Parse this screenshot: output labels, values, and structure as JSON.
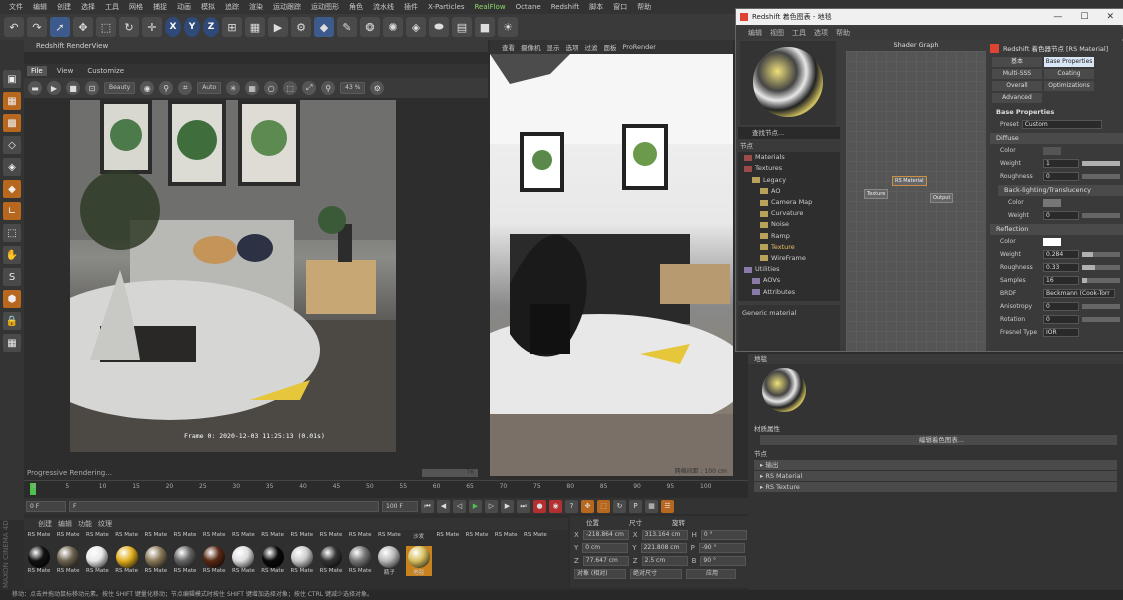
{
  "menu": [
    "文件",
    "编辑",
    "创建",
    "选择",
    "工具",
    "网格",
    "捕捉",
    "动画",
    "模拟",
    "追踪",
    "渲染",
    "运动跟踪",
    "运动图形",
    "角色",
    "流水线",
    "插件",
    "X-Particles",
    "RealFlow",
    "Octane",
    "Redshift",
    "脚本",
    "窗口",
    "帮助"
  ],
  "render_view": {
    "title": "Redshift RenderView",
    "menu": [
      "File",
      "View",
      "Customize"
    ],
    "aov": "Beauty",
    "auto": "Auto",
    "zoom": "43 %",
    "frame_stamp": "Frame  0:  2020-12-03  11:25:13  (0.01s)",
    "progress": "Progressive Rendering...",
    "progress_val": "76"
  },
  "viewport": {
    "menu": [
      "查看",
      "摄像机",
      "显示",
      "选项",
      "过滤",
      "面板",
      "ProRender"
    ],
    "status": "网格间距 : 100 cm"
  },
  "timeline": {
    "ticks": [
      "0",
      "5",
      "10",
      "15",
      "20",
      "25",
      "30",
      "35",
      "40",
      "45",
      "50",
      "55",
      "60",
      "65",
      "70",
      "75",
      "80",
      "85",
      "90",
      "95",
      "100"
    ],
    "start": "0 F",
    "end": "100 F",
    "current": "0 F",
    "max": "100 F",
    "field_f": "F"
  },
  "materials": {
    "menu": [
      "创建",
      "编辑",
      "功能",
      "纹理"
    ],
    "row1": [
      "RS Mate",
      "RS Mate",
      "RS Mate",
      "RS Mate",
      "RS Mate",
      "RS Mate",
      "RS Mate",
      "RS Mate",
      "RS Mate",
      "RS Mate",
      "RS Mate",
      "RS Mate",
      "RS Mate",
      "沙发",
      "RS Mate",
      "RS Mate",
      "RS Mate",
      "RS Mate"
    ],
    "row2": [
      "RS Mate",
      "RS Mate",
      "RS Mate",
      "RS Mate",
      "RS Mate",
      "RS Mate",
      "RS Mate",
      "RS Mate",
      "RS Mate",
      "RS Mate",
      "RS Mate",
      "RS Mate",
      "瓶子",
      "地毯"
    ]
  },
  "coords": {
    "headers": [
      "位置",
      "尺寸",
      "旋转"
    ],
    "x_pos": "-218.864 cm",
    "x_size": "313.164 cm",
    "h": "0 °",
    "y_pos": "0 cm",
    "y_size": "221.808 cm",
    "p": "-90 °",
    "z_pos": "77.647 cm",
    "z_size": "2.5 cm",
    "b": "90 °",
    "mode1": "对象 (相对)",
    "mode2": "绝对尺寸",
    "apply": "应用"
  },
  "status": "移动：点击并拖动鼠标移动元素。按住 SHIFT 键量化移动；节点编辑模式时按住 SHIFT 键增加选择对象；按住 CTRL 键减少选择对象。",
  "cinema_logo": "MAXON CINEMA 4D",
  "node_window": {
    "title": "Redshift 着色图表 - 地毯",
    "menu": [
      "编辑",
      "视图",
      "工具",
      "选项",
      "帮助"
    ],
    "search": "查找节点...",
    "list_header": "节点",
    "nodes": [
      "Materials",
      "Textures",
      "Legacy",
      "AO",
      "Camera Map",
      "Curvature",
      "Noise",
      "Ramp",
      "Texture",
      "WireFrame",
      "Utilities",
      "AOVs",
      "Attributes"
    ],
    "desc": "Generic material",
    "graph_title": "Shader Graph",
    "node_rs": "RS Material",
    "node_tex": "Texture",
    "node_out": "Output"
  },
  "props": {
    "title": "Redshift 着色器节点 [RS Material]",
    "tabs": [
      "基本",
      "Base Properties",
      "Multi-SSS",
      "Coating",
      "Overall",
      "Optimizations",
      "Advanced"
    ],
    "base_props": "Base Properties",
    "preset_label": "Preset",
    "preset": "Custom",
    "diffuse": "Diffuse",
    "color": "Color",
    "weight": "Weight",
    "weight_val": "1",
    "roughness": "Roughness",
    "roughness_val": "0",
    "backlight": "Back-lighting/Translucency",
    "bl_color": "Color",
    "bl_weight": "Weight",
    "bl_weight_val": "0",
    "reflection": "Reflection",
    "r_color": "Color",
    "r_weight": "Weight",
    "r_weight_val": "0.284",
    "r_rough": "Roughness",
    "r_rough_val": "0.33",
    "samples": "Samples",
    "samples_val": "16",
    "brdf": "BRDF",
    "brdf_val": "Beckmann (Cook-Torr",
    "aniso": "Anisotropy",
    "aniso_val": "0",
    "rotation": "Rotation",
    "rotation_val": "0",
    "fresnel": "Fresnel Type",
    "fresnel_val": "IOR"
  },
  "mat_panel": {
    "header": "地毯",
    "mat_props": "材质属性",
    "edit_btn": "编辑着色图表...",
    "nodes": "节点",
    "items": [
      "输出",
      "RS Material",
      "RS Texture"
    ]
  }
}
